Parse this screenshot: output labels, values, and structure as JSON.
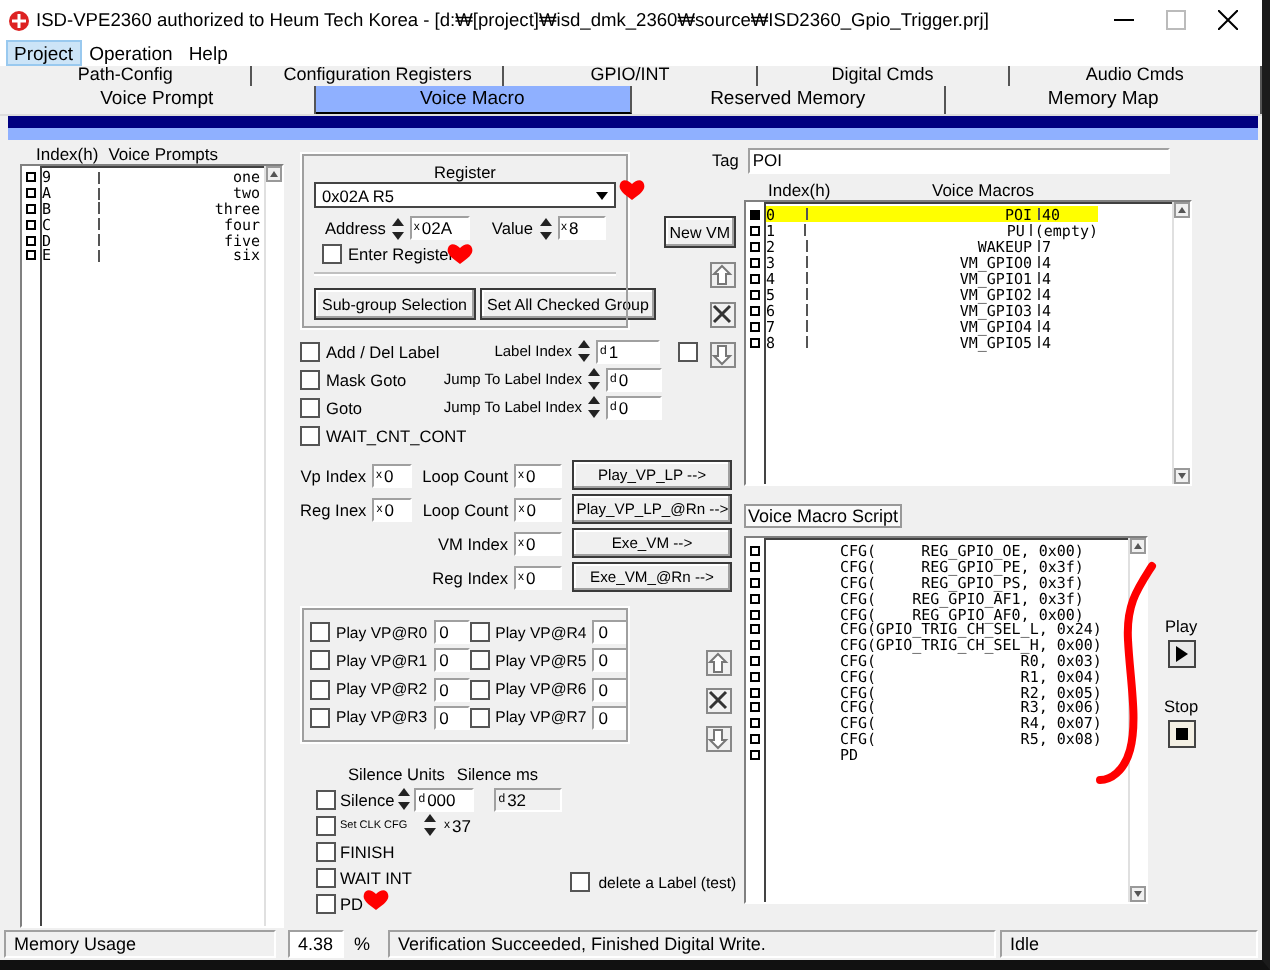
{
  "window": {
    "title": "ISD-VPE2360 authorized to Heum Tech Korea - [d:₩[project]₩isd_dmk_2360₩source₩ISD2360_Gpio_Trigger.prj]"
  },
  "menu": [
    {
      "label": "Project",
      "selected": true
    },
    {
      "label": "Operation",
      "selected": false
    },
    {
      "label": "Help",
      "selected": false
    }
  ],
  "tabs_row_1": [
    "Path-Config",
    "Configuration Registers",
    "GPIO/INT",
    "Digital Cmds",
    "Audio Cmds"
  ],
  "tabs": [
    {
      "label": "Voice Prompt",
      "selected": false
    },
    {
      "label": "Voice Macro",
      "selected": true
    },
    {
      "label": "Reserved Memory",
      "selected": false
    },
    {
      "label": "Memory Map",
      "selected": false
    }
  ],
  "voice_prompts": {
    "columns": [
      "Index(h)",
      "Voice Prompts"
    ],
    "rows": [
      {
        "index": "9",
        "name": "one"
      },
      {
        "index": "A",
        "name": "two"
      },
      {
        "index": "B",
        "name": "three"
      },
      {
        "index": "C",
        "name": "four"
      },
      {
        "index": "D",
        "name": "five"
      },
      {
        "index": "E",
        "name": "six"
      }
    ]
  },
  "register": {
    "title": "Register",
    "selection": "0x02A R5",
    "address": {
      "label": "Address",
      "prefix": "x",
      "value": "02A"
    },
    "value": {
      "label": "Value",
      "prefix": "x",
      "value": "8"
    },
    "enter_register": {
      "label": "Enter Register",
      "checked": false
    },
    "buttons": [
      "Sub-group Selection",
      "Set All Checked Group"
    ]
  },
  "new_vm_button": "New VM",
  "label_options": [
    {
      "label": "Add / Del Label",
      "checked": false
    },
    {
      "label": "Mask Goto",
      "checked": false
    },
    {
      "label": "Goto",
      "checked": false
    },
    {
      "label": "WAIT_CNT_CONT",
      "checked": false
    }
  ],
  "label_fields": [
    {
      "label": "Label Index",
      "prefix": "d",
      "value": "1"
    },
    {
      "label": "Jump To Label Index",
      "prefix": "d",
      "value": "0"
    },
    {
      "label": "Jump To Label Index",
      "prefix": "d",
      "value": "0"
    }
  ],
  "label_extra_check": {
    "checked": false
  },
  "play_rows": [
    {
      "label_1": "Vp Index",
      "prefix_1": "x",
      "value_1": "0",
      "label_2": "Loop Count",
      "prefix_2": "x",
      "value_2": "0",
      "button": "Play_VP_LP -->"
    },
    {
      "label_1": "Reg Inex",
      "prefix_1": "x",
      "value_1": "0",
      "label_2": "Loop Count",
      "prefix_2": "x",
      "value_2": "0",
      "button": "Play_VP_LP_@Rn -->"
    },
    {
      "label_2": "VM Index",
      "prefix_2": "x",
      "value_2": "0",
      "button": "Exe_VM -->"
    },
    {
      "label_2": "Reg Index",
      "prefix_2": "x",
      "value_2": "0",
      "button": "Exe_VM_@Rn -->"
    }
  ],
  "play_vp_registers": [
    {
      "label": "Play VP@R0",
      "value": "0",
      "checked": false
    },
    {
      "label": "Play VP@R1",
      "value": "0",
      "checked": false
    },
    {
      "label": "Play VP@R2",
      "value": "0",
      "checked": false
    },
    {
      "label": "Play VP@R3",
      "value": "0",
      "checked": false
    },
    {
      "label": "Play VP@R4",
      "value": "0",
      "checked": false
    },
    {
      "label": "Play VP@R5",
      "value": "0",
      "checked": false
    },
    {
      "label": "Play VP@R6",
      "value": "0",
      "checked": false
    },
    {
      "label": "Play VP@R7",
      "value": "0",
      "checked": false
    }
  ],
  "silence": {
    "units_label": "Silence Units",
    "ms_label": "Silence ms",
    "units_prefix": "d",
    "units": "000",
    "ms_prefix": "d",
    "ms": "32"
  },
  "commands": [
    {
      "kind": "silence",
      "label": "Silence",
      "checked": false
    },
    {
      "kind": "clock",
      "label": "Set CLK CFG",
      "checked": false,
      "prefix": "x",
      "value": "37"
    },
    {
      "kind": "plain",
      "label": "FINISH",
      "checked": false
    },
    {
      "kind": "plain",
      "label": "WAIT INT",
      "checked": false
    },
    {
      "kind": "plain",
      "label": "PD",
      "checked": false
    }
  ],
  "delete_label": {
    "label": "delete a Label (test)",
    "checked": false
  },
  "tag": {
    "label": "Tag",
    "value": "POI"
  },
  "voice_macros": {
    "columns": [
      "Index(h)",
      "Voice Macros"
    ],
    "rows": [
      {
        "index": "0",
        "name": "POI",
        "size": "40",
        "selected": true
      },
      {
        "index": "1",
        "name": "PU",
        "size": "(empty)",
        "selected": false
      },
      {
        "index": "2",
        "name": "WAKEUP",
        "size": "7",
        "selected": false
      },
      {
        "index": "3",
        "name": "VM_GPIO0",
        "size": "4",
        "selected": false
      },
      {
        "index": "4",
        "name": "VM_GPIO1",
        "size": "4",
        "selected": false
      },
      {
        "index": "5",
        "name": "VM_GPIO2",
        "size": "4",
        "selected": false
      },
      {
        "index": "6",
        "name": "VM_GPIO3",
        "size": "4",
        "selected": false
      },
      {
        "index": "7",
        "name": "VM_GPIO4",
        "size": "4",
        "selected": false
      },
      {
        "index": "8",
        "name": "VM_GPIO5",
        "size": "4",
        "selected": false
      }
    ]
  },
  "script": {
    "title": "Voice Macro Script",
    "lines": [
      "CFG(     REG_GPIO_OE, 0x00)",
      "CFG(     REG_GPIO_PE, 0x3f)",
      "CFG(     REG_GPIO_PS, 0x3f)",
      "CFG(    REG_GPIO_AF1, 0x3f)",
      "CFG(    REG_GPIO_AF0, 0x00)",
      "CFG(GPIO_TRIG_CH_SEL_L, 0x24)",
      "CFG(GPIO_TRIG_CH_SEL_H, 0x00)",
      "CFG(                R0, 0x03)",
      "CFG(                R1, 0x04)",
      "CFG(                R2, 0x05)",
      "CFG(                R3, 0x06)",
      "CFG(                R4, 0x07)",
      "CFG(                R5, 0x08)",
      "PD"
    ]
  },
  "play": {
    "label": "Play"
  },
  "stop": {
    "label": "Stop"
  },
  "status_bar": {
    "memory_label": "Memory Usage",
    "memory_value": "4.38",
    "memory_unit": "%",
    "message": "Verification Succeeded, Finished Digital Write.",
    "state": "Idle"
  }
}
